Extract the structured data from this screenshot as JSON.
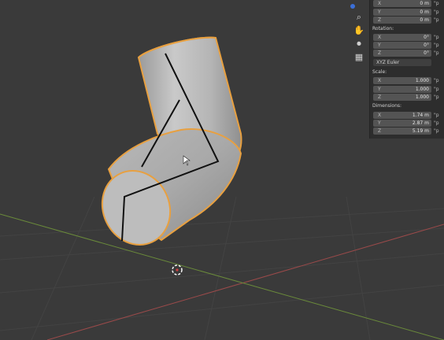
{
  "panel": {
    "location_rows": [
      {
        "axis": "X",
        "value": "0 m",
        "lock": "\"p"
      },
      {
        "axis": "Y",
        "value": "0 m",
        "lock": "\"p"
      },
      {
        "axis": "Z",
        "value": "0 m",
        "lock": "\"p"
      }
    ],
    "rotation_label": "Rotation:",
    "rotation_rows": [
      {
        "axis": "X",
        "value": "0°",
        "lock": "\"p"
      },
      {
        "axis": "Y",
        "value": "0°",
        "lock": "\"p"
      },
      {
        "axis": "Z",
        "value": "0°",
        "lock": "\"p"
      }
    ],
    "rotation_mode": "XYZ Euler",
    "scale_label": "Scale:",
    "scale_rows": [
      {
        "axis": "X",
        "value": "1.000",
        "lock": "\"p"
      },
      {
        "axis": "Y",
        "value": "1.000",
        "lock": "\"p"
      },
      {
        "axis": "Z",
        "value": "1.000",
        "lock": "\"p"
      }
    ],
    "dimensions_label": "Dimensions:",
    "dimensions_rows": [
      {
        "axis": "X",
        "value": "1.74 m",
        "lock": "\"p"
      },
      {
        "axis": "Y",
        "value": "2.87 m",
        "lock": "\"p"
      },
      {
        "axis": "Z",
        "value": "5.19 m",
        "lock": "\"p"
      }
    ]
  },
  "nav": {
    "zoom_icon": "zoom-icon",
    "pan_icon": "hand-icon",
    "camera_icon": "camera-icon",
    "grid_icon": "grid-icon"
  },
  "colors": {
    "background": "#3a3a3a",
    "grid_line": "#454545",
    "x_axis": "#9a4a4a",
    "y_axis": "#6a8a3a",
    "selection_outline": "#e8a040"
  }
}
